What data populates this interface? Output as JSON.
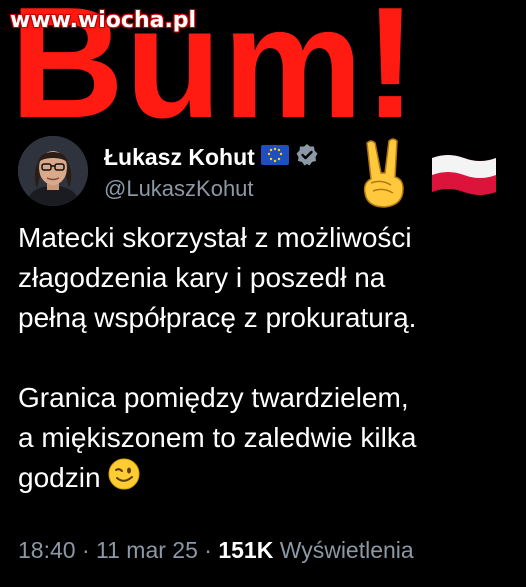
{
  "watermark": "www.wiocha.pl",
  "headline": "Bum!",
  "tweet": {
    "author_name": "Łukasz Kohut",
    "handle": "@LukaszKohut",
    "lines": [
      "Matecki skorzystał z możliwości",
      "złagodzenia kary i poszedł na",
      "pełną współpracę z prokuraturą.",
      "Granica pomiędzy twardzielem,",
      "a miękiszonem to zaledwie kilka",
      "godzin"
    ],
    "time": "18:40",
    "sep": "·",
    "date": "11 mar 25",
    "views": "151K",
    "views_label": "Wyświetlenia"
  },
  "icons": [
    "eu-flag-icon",
    "verified-badge-icon",
    "victory-hand-emoji-icon",
    "poland-flag-emoji-icon",
    "winking-face-emoji-icon"
  ],
  "colors": {
    "headline": "#ff1a12",
    "background": "#000000",
    "secondary_text": "#8b98a5"
  }
}
